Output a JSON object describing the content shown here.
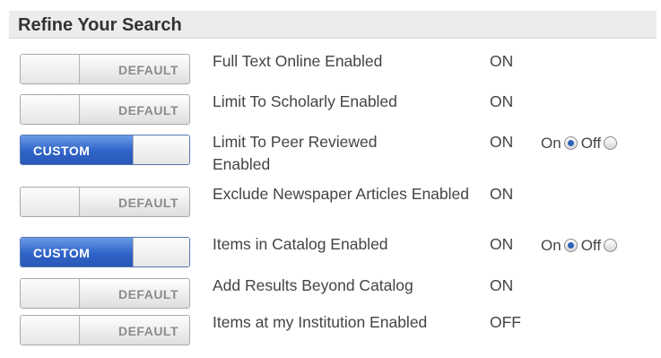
{
  "panel": {
    "title": "Refine Your Search"
  },
  "rows": [
    {
      "toggle": "DEFAULT",
      "name": "Full Text Online Enabled",
      "status": "ON"
    },
    {
      "toggle": "DEFAULT",
      "name": "Limit To Scholarly Enabled",
      "status": "ON"
    },
    {
      "toggle": "CUSTOM",
      "name": "Limit To Peer Reviewed Enabled",
      "status": "ON",
      "radio": {
        "on_label": "On",
        "off_label": "Off",
        "selected": "On"
      }
    },
    {
      "toggle": "DEFAULT",
      "name": "Exclude Newspaper Articles Enabled",
      "status": "ON"
    },
    {
      "toggle": "CUSTOM",
      "name": "Items in Catalog Enabled",
      "status": "ON",
      "radio": {
        "on_label": "On",
        "off_label": "Off",
        "selected": "On"
      }
    },
    {
      "toggle": "DEFAULT",
      "name": "Add Results Beyond Catalog",
      "status": "ON"
    },
    {
      "toggle": "DEFAULT",
      "name": "Items at my Institution Enabled",
      "status": "OFF"
    }
  ],
  "colors": {
    "custom_blue": "#2f63c8",
    "header_bg": "#ececec",
    "text": "#444444"
  }
}
